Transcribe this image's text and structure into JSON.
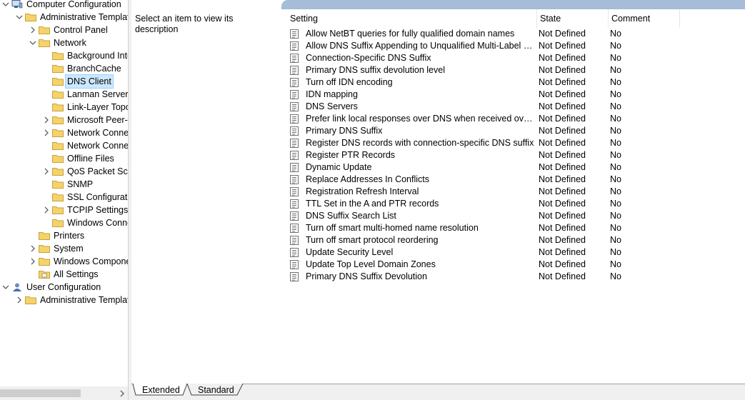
{
  "tree": {
    "items": [
      {
        "label": "Computer Configuration",
        "level": 0,
        "expand": "open",
        "icon": "computer-icon"
      },
      {
        "label": "Administrative Templates",
        "level": 1,
        "expand": "open",
        "icon": "folder-icon"
      },
      {
        "label": "Control Panel",
        "level": 2,
        "expand": "closed",
        "icon": "folder-icon"
      },
      {
        "label": "Network",
        "level": 2,
        "expand": "open",
        "icon": "folder-icon"
      },
      {
        "label": "Background Inte",
        "level": 3,
        "expand": "none",
        "icon": "folder-icon"
      },
      {
        "label": "BranchCache",
        "level": 3,
        "expand": "none",
        "icon": "folder-icon"
      },
      {
        "label": "DNS Client",
        "level": 3,
        "expand": "none",
        "icon": "folder-icon",
        "selected": true
      },
      {
        "label": "Lanman Server",
        "level": 3,
        "expand": "none",
        "icon": "folder-icon"
      },
      {
        "label": "Link-Layer Topol",
        "level": 3,
        "expand": "none",
        "icon": "folder-icon"
      },
      {
        "label": "Microsoft Peer-to",
        "level": 3,
        "expand": "closed",
        "icon": "folder-icon"
      },
      {
        "label": "Network Connect",
        "level": 3,
        "expand": "closed",
        "icon": "folder-icon"
      },
      {
        "label": "Network Connect",
        "level": 3,
        "expand": "none",
        "icon": "folder-icon"
      },
      {
        "label": "Offline Files",
        "level": 3,
        "expand": "none",
        "icon": "folder-icon"
      },
      {
        "label": "QoS Packet Sche",
        "level": 3,
        "expand": "closed",
        "icon": "folder-icon"
      },
      {
        "label": "SNMP",
        "level": 3,
        "expand": "none",
        "icon": "folder-icon"
      },
      {
        "label": "SSL Configuratio",
        "level": 3,
        "expand": "none",
        "icon": "folder-icon"
      },
      {
        "label": "TCPIP Settings",
        "level": 3,
        "expand": "closed",
        "icon": "folder-icon"
      },
      {
        "label": "Windows Conne",
        "level": 3,
        "expand": "none",
        "icon": "folder-icon"
      },
      {
        "label": "Printers",
        "level": 2,
        "expand": "none",
        "icon": "folder-icon"
      },
      {
        "label": "System",
        "level": 2,
        "expand": "closed",
        "icon": "folder-icon"
      },
      {
        "label": "Windows Componer",
        "level": 2,
        "expand": "closed",
        "icon": "folder-icon"
      },
      {
        "label": "All Settings",
        "level": 2,
        "expand": "none",
        "icon": "all-settings-icon"
      },
      {
        "label": "User Configuration",
        "level": 0,
        "expand": "open",
        "icon": "user-icon"
      },
      {
        "label": "Administrative Template",
        "level": 1,
        "expand": "closed",
        "icon": "folder-icon"
      }
    ]
  },
  "description": {
    "text": "Select an item to view its description"
  },
  "columns": {
    "setting": "Setting",
    "state": "State",
    "comment": "Comment"
  },
  "rows": [
    {
      "name": "Allow NetBT queries for fully qualified domain names",
      "state": "Not Defined",
      "comment": "No"
    },
    {
      "name": "Allow DNS Suffix Appending to Unqualified Multi-Label Name Qu",
      "state": "Not Defined",
      "comment": "No"
    },
    {
      "name": "Connection-Specific DNS Suffix",
      "state": "Not Defined",
      "comment": "No"
    },
    {
      "name": "Primary DNS suffix devolution level",
      "state": "Not Defined",
      "comment": "No"
    },
    {
      "name": "Turn off IDN encoding",
      "state": "Not Defined",
      "comment": "No"
    },
    {
      "name": "IDN mapping",
      "state": "Not Defined",
      "comment": "No"
    },
    {
      "name": "DNS Servers",
      "state": "Not Defined",
      "comment": "No"
    },
    {
      "name": "Prefer link local responses over DNS when received over a n...",
      "state": "Not Defined",
      "comment": "No"
    },
    {
      "name": "Primary DNS Suffix",
      "state": "Not Defined",
      "comment": "No"
    },
    {
      "name": "Register DNS records with connection-specific DNS suffix",
      "state": "Not Defined",
      "comment": "No"
    },
    {
      "name": "Register PTR Records",
      "state": "Not Defined",
      "comment": "No"
    },
    {
      "name": "Dynamic Update",
      "state": "Not Defined",
      "comment": "No"
    },
    {
      "name": "Replace Addresses In Conflicts",
      "state": "Not Defined",
      "comment": "No"
    },
    {
      "name": "Registration Refresh Interval",
      "state": "Not Defined",
      "comment": "No"
    },
    {
      "name": "TTL Set in the A and PTR records",
      "state": "Not Defined",
      "comment": "No"
    },
    {
      "name": "DNS Suffix Search List",
      "state": "Not Defined",
      "comment": "No"
    },
    {
      "name": "Turn off smart multi-homed name resolution",
      "state": "Not Defined",
      "comment": "No"
    },
    {
      "name": "Turn off smart protocol reordering",
      "state": "Not Defined",
      "comment": "No"
    },
    {
      "name": "Update Security Level",
      "state": "Not Defined",
      "comment": "No"
    },
    {
      "name": "Update Top Level Domain Zones",
      "state": "Not Defined",
      "comment": "No"
    },
    {
      "name": "Primary DNS Suffix Devolution",
      "state": "Not Defined",
      "comment": "No"
    }
  ],
  "tabs": {
    "extended": "Extended",
    "standard": "Standard"
  },
  "colors": {
    "selection": "#cce8ff",
    "selection_border": "#99d1ff",
    "folder": "#f5d36b",
    "header_strip": "#a6bcd7"
  }
}
